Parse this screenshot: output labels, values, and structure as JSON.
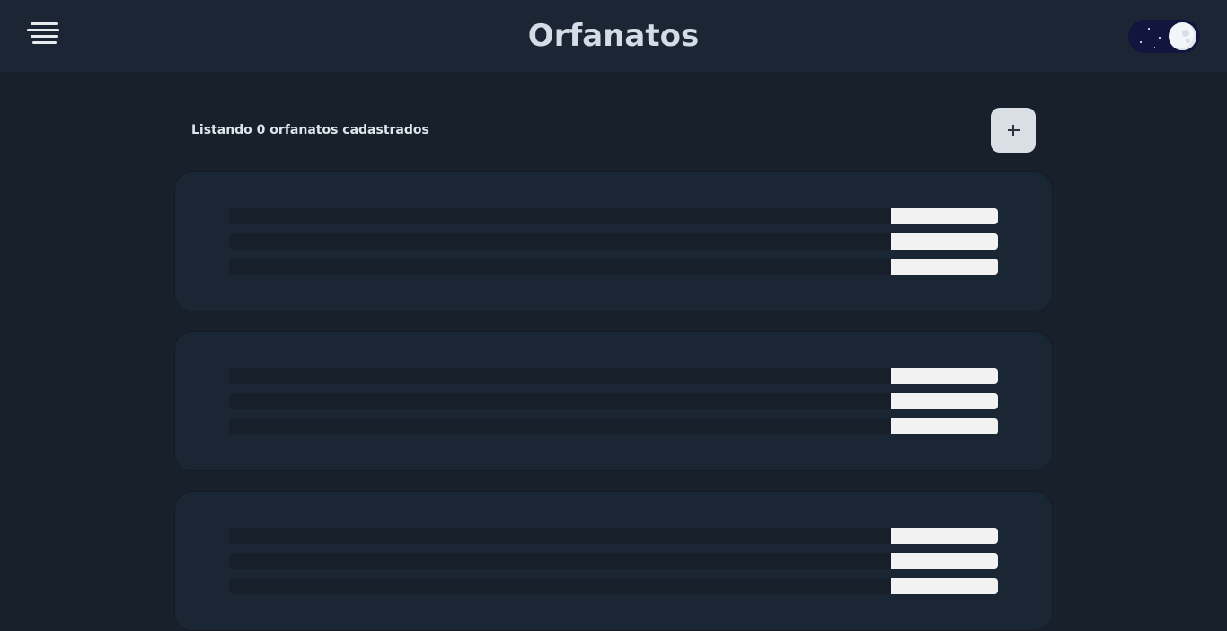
{
  "header": {
    "title": "Orfanatos",
    "menu_icon": "hamburger-menu-icon",
    "theme_toggle": {
      "mode": "dark",
      "icon": "moon-icon"
    }
  },
  "main": {
    "count_text": "Listando 0 orfanatos cadastrados",
    "add_button_icon": "plus-icon",
    "loading_cards": [
      {
        "state": "loading",
        "rows": 3
      },
      {
        "state": "loading",
        "rows": 3
      },
      {
        "state": "loading",
        "rows": 3
      }
    ]
  },
  "colors": {
    "background": "#18202b",
    "header": "#1b2533",
    "card": "#1b2634",
    "title": "#d4dde6",
    "toggle_track": "#12163f",
    "add_button": "#d9dfe5",
    "skeleton_highlight": "#f2f2f2"
  }
}
